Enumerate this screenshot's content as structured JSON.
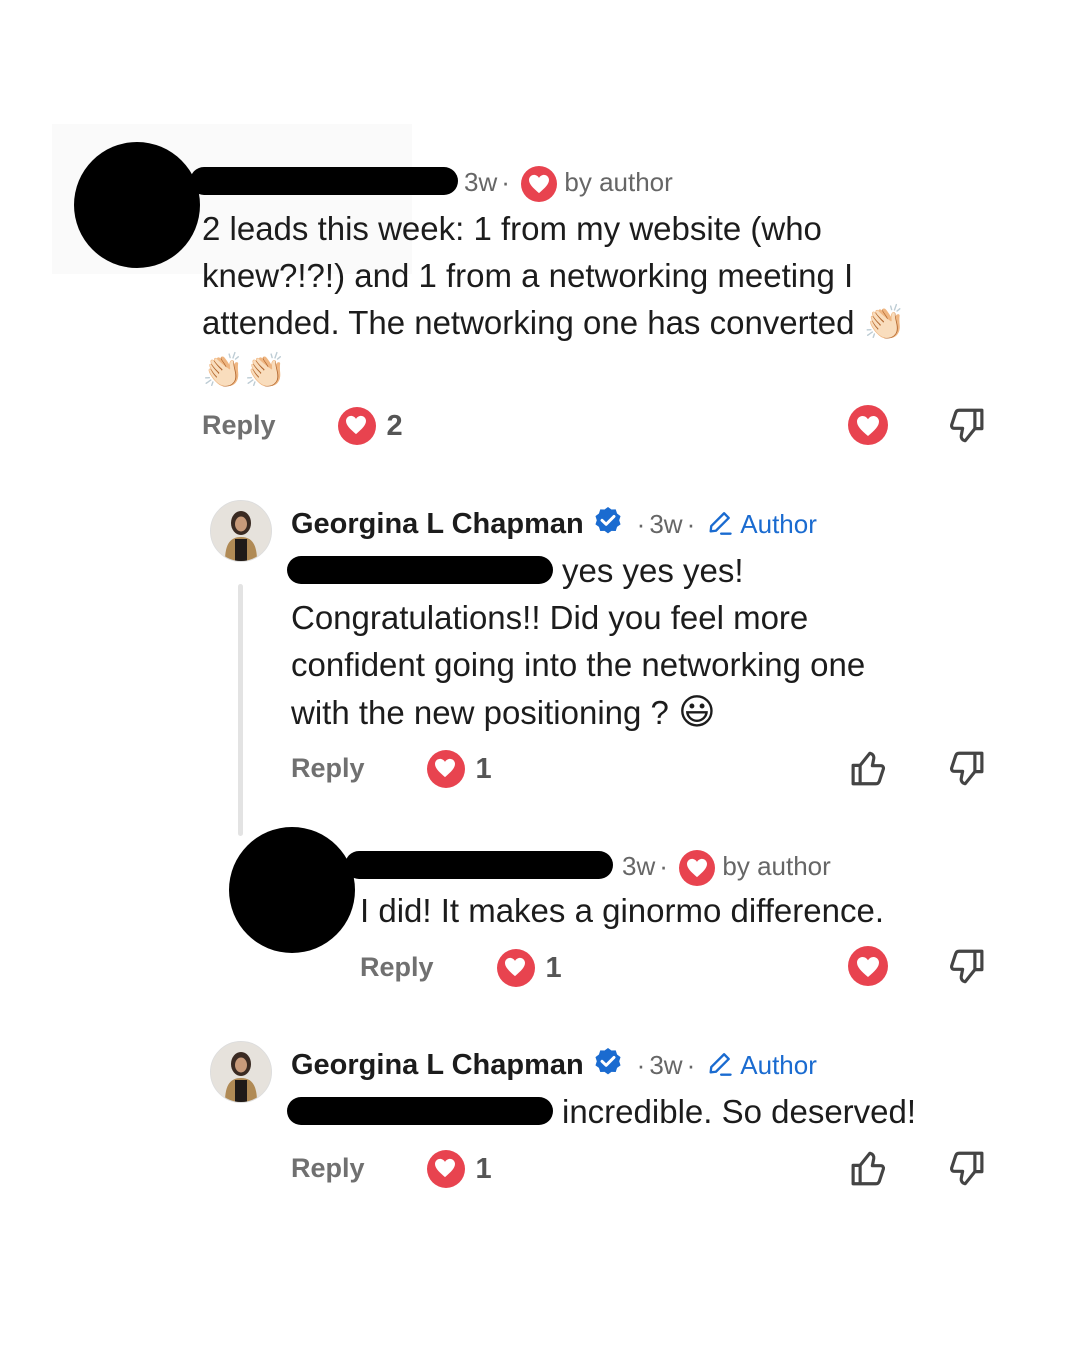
{
  "comments": [
    {
      "time": "3w",
      "badge": "by author",
      "text_lines": [
        "2 leads this week: 1 from my website (who",
        "knew?!?!) and 1 from a networking meeting I",
        "attended. The networking one has converted"
      ],
      "emoji": "👏🏻",
      "reply_label": "Reply",
      "like_count": "2"
    },
    {
      "name": "Georgina L Chapman",
      "time": "3w",
      "badge": "Author",
      "text_first": "yes yes yes!",
      "text_lines": [
        "Congratulations!! Did you feel more",
        "confident going into the networking one",
        "with the new positioning ?"
      ],
      "emoji": "😃",
      "reply_label": "Reply",
      "like_count": "1"
    },
    {
      "time": "3w",
      "badge": "by author",
      "text": "I did! It makes a ginormo difference.",
      "reply_label": "Reply",
      "like_count": "1"
    },
    {
      "name": "Georgina L Chapman",
      "time": "3w",
      "badge": "Author",
      "text_first": "incredible. So deserved!",
      "reply_label": "Reply",
      "like_count": "1"
    }
  ],
  "icons": {
    "heart": "heart-icon",
    "like": "thumbs-up-icon",
    "dislike": "thumbs-down-icon",
    "verified": "verified-badge-icon",
    "pencil": "pencil-icon"
  },
  "colors": {
    "heart": "#e8434f",
    "author_blue": "#1a6bd0",
    "meta_gray": "#666666"
  }
}
